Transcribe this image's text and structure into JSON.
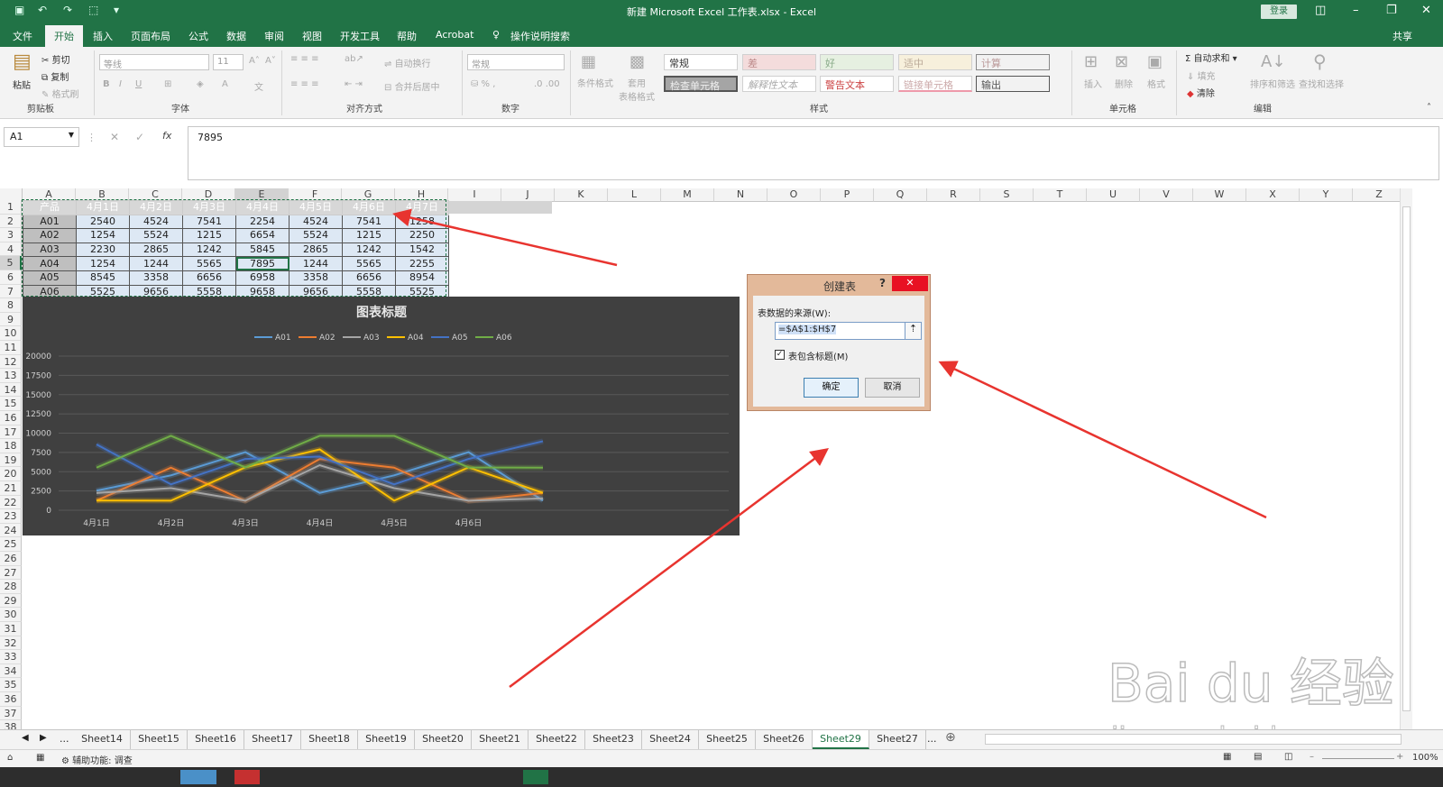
{
  "app": {
    "title": "新建 Microsoft Excel 工作表.xlsx  -  Excel",
    "login_label": "登录",
    "share_label": "共享"
  },
  "menu": [
    "文件",
    "开始",
    "插入",
    "页面布局",
    "公式",
    "数据",
    "审阅",
    "视图",
    "开发工具",
    "帮助",
    "Acrobat",
    "操作说明搜索"
  ],
  "ribbon": {
    "clipboard": {
      "paste": "粘贴",
      "cut": "剪切",
      "copy": "复制",
      "format_painter": "格式刷",
      "group": "剪贴板"
    },
    "font": {
      "name": "等线",
      "size": "11",
      "group": "字体"
    },
    "alignment": {
      "wrap": "自动换行",
      "merge": "合并后居中",
      "group": "对齐方式"
    },
    "number": {
      "format": "常规",
      "group": "数字"
    },
    "styles": {
      "conditional": "条件格式",
      "table_format": "套用\n表格格式",
      "normal": "常规",
      "bad": "差",
      "good": "好",
      "neutral": "适中",
      "calc": "计算",
      "check": "检查单元格",
      "explain": "解释性文本",
      "warn": "警告文本",
      "link": "链接单元格",
      "output": "输出",
      "group": "样式"
    },
    "cells": {
      "insert": "插入",
      "delete": "删除",
      "format": "格式",
      "group": "单元格"
    },
    "editing": {
      "autosum": "自动求和",
      "fill": "填充",
      "clear": "清除",
      "sort": "排序和筛选",
      "find": "查找和选择",
      "group": "编辑"
    }
  },
  "formula_bar": {
    "name_box": "A1",
    "fx": "fx",
    "content": "7895"
  },
  "columns": [
    "A",
    "B",
    "C",
    "D",
    "E",
    "F",
    "G",
    "H",
    "I",
    "J",
    "K",
    "L",
    "M",
    "N",
    "O",
    "P",
    "Q",
    "R",
    "S",
    "T",
    "U",
    "V",
    "W",
    "X",
    "Y",
    "Z"
  ],
  "rows": [
    "1",
    "2",
    "3",
    "4",
    "5",
    "6",
    "7",
    "8",
    "9",
    "10",
    "11",
    "12",
    "13",
    "14",
    "15",
    "16",
    "17",
    "18",
    "19",
    "20",
    "21",
    "22",
    "23",
    "24",
    "25",
    "26",
    "27",
    "28",
    "29",
    "30",
    "31",
    "32",
    "33",
    "34",
    "35",
    "36",
    "37",
    "38"
  ],
  "table": {
    "header": [
      "产品",
      "4月1日",
      "4月2日",
      "4月3日",
      "4月4日",
      "4月5日",
      "4月6日",
      "4月7日"
    ],
    "rows": [
      [
        "A01",
        "2540",
        "4524",
        "7541",
        "2254",
        "4524",
        "7541",
        "1258"
      ],
      [
        "A02",
        "1254",
        "5524",
        "1215",
        "6654",
        "5524",
        "1215",
        "2250"
      ],
      [
        "A03",
        "2230",
        "2865",
        "1242",
        "5845",
        "2865",
        "1242",
        "1542"
      ],
      [
        "A04",
        "1254",
        "1244",
        "5565",
        "7895",
        "1244",
        "5565",
        "2255"
      ],
      [
        "A05",
        "8545",
        "3358",
        "6656",
        "6958",
        "3358",
        "6656",
        "8954"
      ],
      [
        "A06",
        "5525",
        "9656",
        "5558",
        "9658",
        "9656",
        "5558",
        "5525"
      ]
    ]
  },
  "chart_data": {
    "type": "line",
    "title": "图表标题",
    "categories": [
      "4月1日",
      "4月2日",
      "4月3日",
      "4月4日",
      "4月5日",
      "4月6日",
      "4月7日"
    ],
    "x_tick_labels": [
      "4月1日",
      "4月2日",
      "4月3日",
      "4月4日",
      "4月5日",
      "4月6日"
    ],
    "yticks": [
      "0",
      "2500",
      "5000",
      "7500",
      "10000",
      "12500",
      "15000",
      "17500",
      "20000"
    ],
    "ylim": [
      0,
      20000
    ],
    "legend_position": "top",
    "grid": true,
    "series": [
      {
        "name": "A01",
        "color": "#5b9bd5",
        "values": [
          2540,
          4524,
          7541,
          2254,
          4524,
          7541,
          1258
        ]
      },
      {
        "name": "A02",
        "color": "#ed7d31",
        "values": [
          1254,
          5524,
          1215,
          6654,
          5524,
          1215,
          2250
        ]
      },
      {
        "name": "A03",
        "color": "#a5a5a5",
        "values": [
          2230,
          2865,
          1242,
          5845,
          2865,
          1242,
          1542
        ]
      },
      {
        "name": "A04",
        "color": "#ffc000",
        "values": [
          1254,
          1244,
          5565,
          7895,
          1244,
          5565,
          2255
        ]
      },
      {
        "name": "A05",
        "color": "#4472c4",
        "values": [
          8545,
          3358,
          6656,
          6958,
          3358,
          6656,
          8954
        ]
      },
      {
        "name": "A06",
        "color": "#70ad47",
        "values": [
          5525,
          9656,
          5558,
          9658,
          9656,
          5558,
          5525
        ]
      }
    ]
  },
  "dialog": {
    "title": "创建表",
    "help": "?",
    "close": "✕",
    "source_label": "表数据的来源(W):",
    "range": "=$A$1:$H$7",
    "has_headers": "表包含标题(M)",
    "ok": "确定",
    "cancel": "取消"
  },
  "sheet_tabs": [
    "Sheet14",
    "Sheet15",
    "Sheet16",
    "Sheet17",
    "Sheet18",
    "Sheet19",
    "Sheet20",
    "Sheet21",
    "Sheet22",
    "Sheet23",
    "Sheet24",
    "Sheet25",
    "Sheet26",
    "Sheet29",
    "Sheet27"
  ],
  "active_sheet": "Sheet29",
  "status": {
    "accessibility": "辅助功能: 调查",
    "zoom": "100%"
  },
  "watermark": {
    "brand": "Bai du 经验",
    "url": "jingyan.baidu.com"
  }
}
